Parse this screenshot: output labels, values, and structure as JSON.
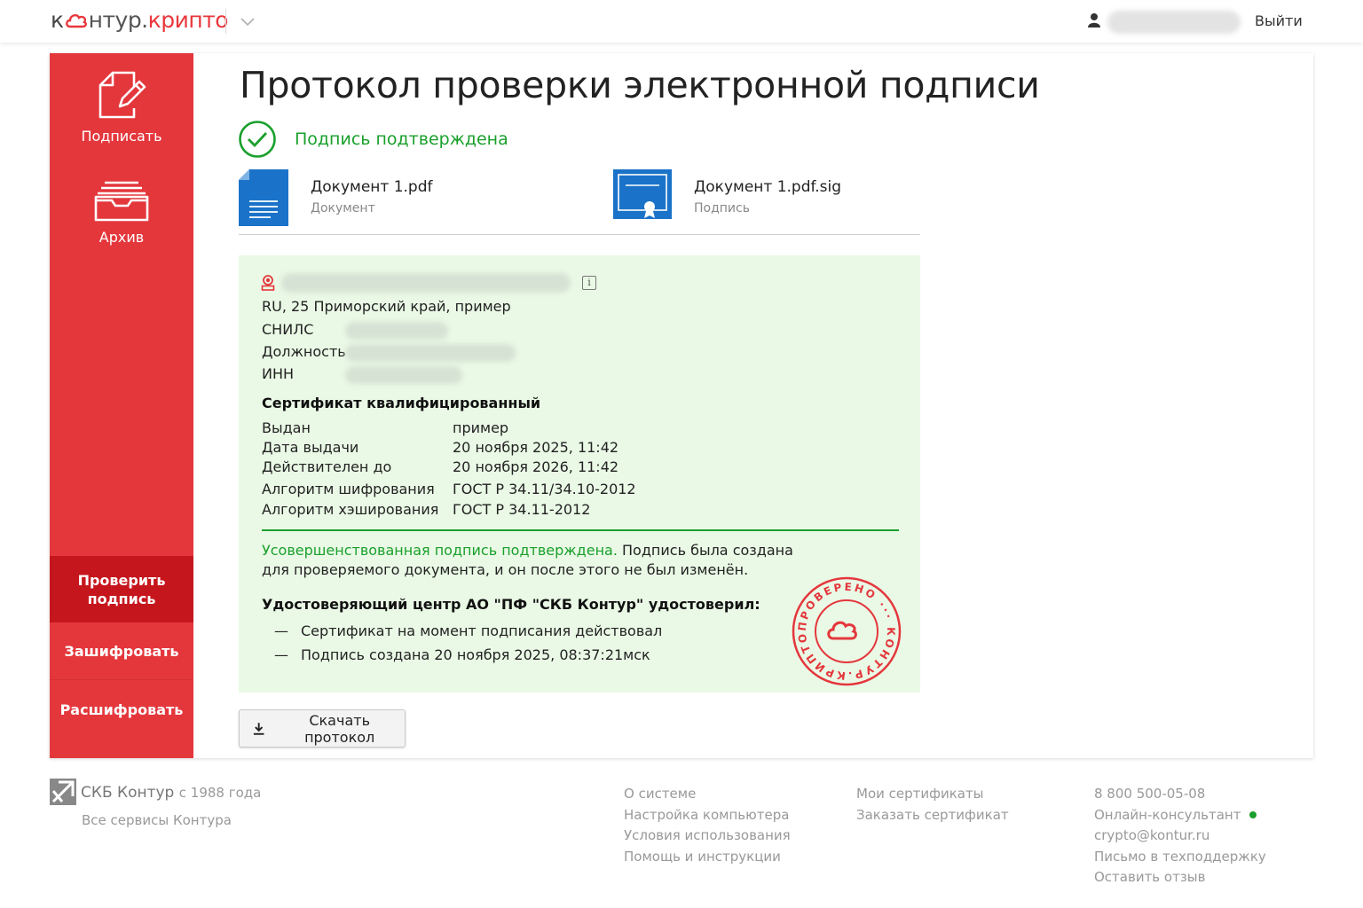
{
  "header": {
    "logo_part1": "к",
    "logo_part2": "нтур.",
    "logo_part3": "крипто",
    "logout": "Выйти"
  },
  "sidebar": {
    "sign_label": "Подписать",
    "archive_label": "Архив",
    "menu": [
      {
        "label": "Проверить подпись",
        "active": true
      },
      {
        "label": "Зашифровать",
        "active": false
      },
      {
        "label": "Расшифровать",
        "active": false
      }
    ]
  },
  "main": {
    "title": "Протокол проверки электронной подписи",
    "status": "Подпись подтверждена",
    "documents": [
      {
        "name": "Документ 1.pdf",
        "type": "Документ",
        "icon": "document-icon"
      },
      {
        "name": "Документ 1.pdf.sig",
        "type": "Подпись",
        "icon": "certificate-icon"
      }
    ],
    "signer": {
      "address": "RU, 25 Приморский край, пример",
      "fields": [
        "СНИЛС",
        "Должность",
        "ИНН"
      ]
    },
    "certificate": {
      "title": "Сертификат квалифицированный",
      "rows": [
        {
          "label": "Выдан",
          "value": "пример"
        },
        {
          "label": "Дата выдачи",
          "value": "20 ноября 2025, 11:42"
        },
        {
          "label": "Действителен до",
          "value": "20 ноября 2026, 11:42"
        },
        {
          "label": "Алгоритм шифрования",
          "value": "ГОСТ Р 34.11/34.10-2012"
        },
        {
          "label": "Алгоритм хэширования",
          "value": "ГОСТ Р 34.11-2012"
        }
      ]
    },
    "result_green": "Усовершенствованная подпись подтверждена.",
    "result_text": " Подпись была создана для проверяемого документа, и он после этого не был изменён.",
    "ca_title": "Удостоверяющий центр АО \"ПФ \"СКБ Контур\" удостоверил:",
    "ca_items": [
      "Сертификат на момент подписания действовал",
      "Подпись создана 20 ноября 2025, 08:37:21мск"
    ],
    "stamp_text": "ПРОВЕРЕНО ··· КОНТУР.КРИПТО ···",
    "download_button": "Скачать протокол"
  },
  "footer": {
    "brand": "СКБ Контур",
    "since": "с 1988 года",
    "all_services": "Все сервисы Контура",
    "col1": [
      "О системе",
      "Настройка компьютера",
      "Условия использования",
      "Помощь и инструкции"
    ],
    "col2": [
      "Мои сертификаты",
      "Заказать сертификат"
    ],
    "col3": [
      "8 800 500-05-08",
      "Онлайн-консультант",
      "crypto@kontur.ru",
      "Письмо в техподдержку",
      "Оставить отзыв"
    ]
  },
  "colors": {
    "brand_red": "#e4373c",
    "active_red": "#c6161d",
    "success_green": "#1aa02c",
    "doc_blue": "#1a73c9"
  }
}
